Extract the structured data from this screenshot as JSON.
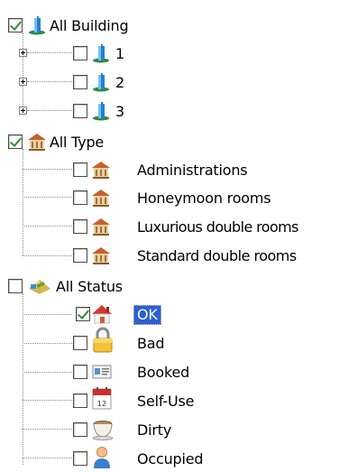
{
  "tree": {
    "building": {
      "label": "All Building",
      "checked": true,
      "children": [
        {
          "label": "1",
          "checked": false
        },
        {
          "label": "2",
          "checked": false
        },
        {
          "label": "3",
          "checked": false
        }
      ]
    },
    "type": {
      "label": "All Type",
      "checked": true,
      "children": [
        {
          "label": "Administrations",
          "checked": false
        },
        {
          "label": "Honeymoon rooms",
          "checked": false
        },
        {
          "label": "Luxurious double rooms",
          "checked": false
        },
        {
          "label": "Standard double rooms",
          "checked": false
        }
      ]
    },
    "status": {
      "label": "All Status",
      "checked": false,
      "children": [
        {
          "label": "OK",
          "checked": true,
          "icon": "house-icon",
          "selected": true
        },
        {
          "label": "Bad",
          "checked": false,
          "icon": "padlock-icon"
        },
        {
          "label": "Booked",
          "checked": false,
          "icon": "id-card-icon"
        },
        {
          "label": "Self-Use",
          "checked": false,
          "icon": "calendar-icon"
        },
        {
          "label": "Dirty",
          "checked": false,
          "icon": "cup-icon"
        },
        {
          "label": "Occupied",
          "checked": false,
          "icon": "person-icon"
        }
      ]
    }
  }
}
